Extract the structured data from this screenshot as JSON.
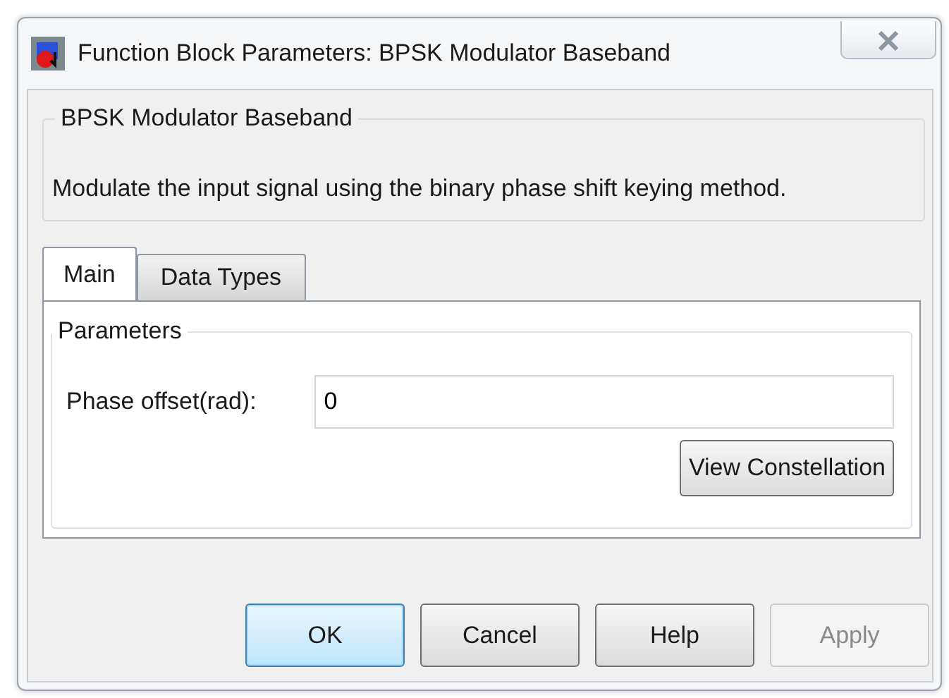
{
  "window": {
    "title": "Function Block Parameters: BPSK Modulator Baseband"
  },
  "description": {
    "title": "BPSK Modulator Baseband",
    "text": "Modulate the input signal using the binary phase shift keying method."
  },
  "tabs": [
    {
      "label": "Main",
      "selected": true
    },
    {
      "label": "Data Types",
      "selected": false
    }
  ],
  "parameters": {
    "title": "Parameters",
    "fields": [
      {
        "label": "Phase offset(rad):",
        "value": "0"
      }
    ],
    "action": {
      "label": "View Constellation"
    }
  },
  "buttons": [
    {
      "label": "OK",
      "default": true,
      "disabled": false
    },
    {
      "label": "Cancel",
      "default": false,
      "disabled": false
    },
    {
      "label": "Help",
      "default": false,
      "disabled": false
    },
    {
      "label": "Apply",
      "default": false,
      "disabled": true
    }
  ]
}
